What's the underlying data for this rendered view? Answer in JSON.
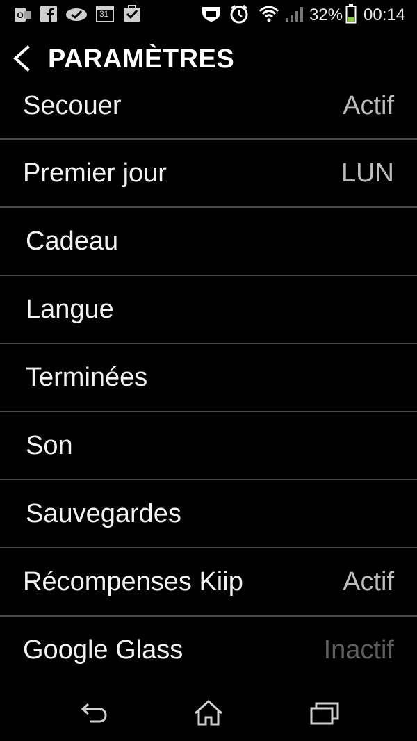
{
  "status_bar": {
    "left_icons": [
      "outlook-icon",
      "facebook-icon",
      "sync-check-icon",
      "calendar-icon",
      "task-check-icon"
    ],
    "calendar_day": "31",
    "battery_percent": "32%",
    "battery_level": 0.32,
    "time": "00:14",
    "right_icons": [
      "vpn-shield-icon",
      "alarm-clock-icon",
      "wifi-icon",
      "signal-icon",
      "battery-icon"
    ]
  },
  "header": {
    "title": "PARAMÈTRES"
  },
  "settings": [
    {
      "label": "Secouer",
      "value": "Actif"
    },
    {
      "label": "Premier jour",
      "value": "LUN"
    },
    {
      "label": "Cadeau",
      "value": ""
    },
    {
      "label": "Langue",
      "value": ""
    },
    {
      "label": "Terminées",
      "value": ""
    },
    {
      "label": "Son",
      "value": ""
    },
    {
      "label": "Sauvegardes",
      "value": ""
    },
    {
      "label": "Récompenses Kiip",
      "value": "Actif"
    },
    {
      "label": "Google Glass",
      "value": "Inactif"
    }
  ],
  "colors": {
    "background": "#000000",
    "text": "#f2f2f2",
    "value_text": "#bdbdbd",
    "inactive_text": "#5e5e5e",
    "divider": "#4a4a4a",
    "battery_fill": "#8bc34a"
  },
  "nav_bar": {
    "icons": [
      "back-icon",
      "home-icon",
      "recents-icon"
    ]
  }
}
